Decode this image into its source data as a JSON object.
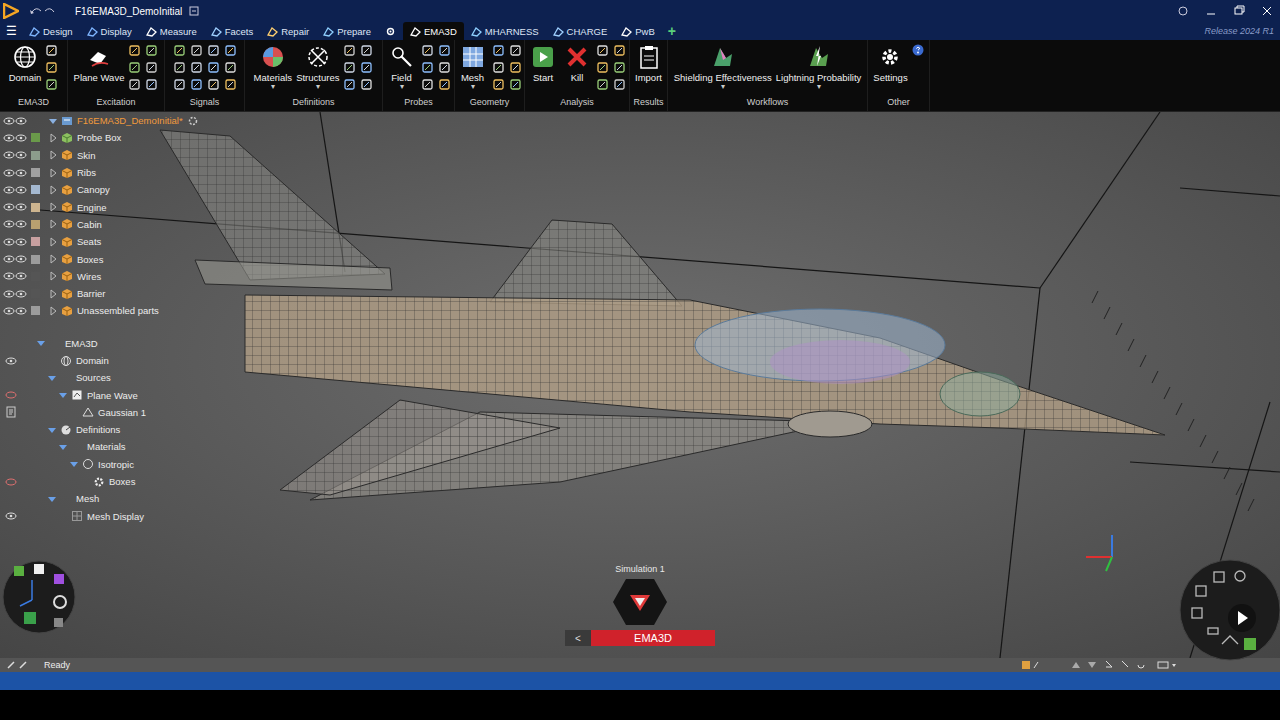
{
  "window": {
    "title": "F16EMA3D_DemoInitial",
    "release": "Release 2024 R1",
    "menu": "☰",
    "add_tab": "+",
    "dropdown_glyph": "▾"
  },
  "tabs": [
    {
      "kind": "text",
      "label": "Design",
      "selected": false
    },
    {
      "kind": "text",
      "label": "Display",
      "selected": false
    },
    {
      "kind": "text",
      "label": "Measure",
      "selected": false
    },
    {
      "kind": "text",
      "label": "Facets",
      "selected": false
    },
    {
      "kind": "text",
      "label": "Repair",
      "selected": false
    },
    {
      "kind": "text",
      "label": "Prepare",
      "selected": false
    },
    {
      "kind": "icon",
      "label": "",
      "selected": false
    },
    {
      "kind": "text",
      "label": "EMA3D",
      "selected": true
    },
    {
      "kind": "text",
      "label": "MHARNESS",
      "selected": false
    },
    {
      "kind": "text",
      "label": "CHARGE",
      "selected": false
    },
    {
      "kind": "text",
      "label": "PwB",
      "selected": false
    }
  ],
  "ribbon": [
    {
      "label": "EMA3D",
      "buttons": [
        {
          "label": "Domain",
          "dropdown": false
        }
      ]
    },
    {
      "label": "Excitation",
      "buttons": [
        {
          "label": "Plane Wave",
          "dropdown": false
        }
      ]
    },
    {
      "label": "Signals",
      "buttons": []
    },
    {
      "label": "Definitions",
      "buttons": [
        {
          "label": "Materials",
          "dropdown": true
        },
        {
          "label": "Structures",
          "dropdown": true
        }
      ]
    },
    {
      "label": "Probes",
      "buttons": [
        {
          "label": "Field",
          "dropdown": true
        }
      ]
    },
    {
      "label": "Geometry",
      "buttons": [
        {
          "label": "Mesh",
          "dropdown": true
        }
      ]
    },
    {
      "label": "Analysis",
      "buttons": [
        {
          "label": "Start",
          "dropdown": false
        },
        {
          "label": "Kill",
          "dropdown": false
        }
      ]
    },
    {
      "label": "Results",
      "buttons": [
        {
          "label": "Import",
          "dropdown": false
        }
      ]
    },
    {
      "label": "Workflows",
      "buttons": [
        {
          "label": "Shielding Effectiveness",
          "dropdown": true
        },
        {
          "label": "Lightning Probability",
          "dropdown": true
        }
      ]
    },
    {
      "label": "Other",
      "buttons": [
        {
          "label": "Settings",
          "dropdown": false
        }
      ]
    }
  ],
  "structure_tree": {
    "root": {
      "label": "F16EMA3D_DemoInitial*",
      "expanded": true
    },
    "items": [
      {
        "label": "Probe Box",
        "visible": true,
        "expanded": false,
        "kind": "body",
        "color": "#6a9a4a"
      },
      {
        "label": "Skin",
        "visible": true,
        "expanded": false,
        "kind": "component",
        "color": "#8c9c8c"
      },
      {
        "label": "Ribs",
        "visible": true,
        "expanded": false,
        "kind": "component",
        "color": "#a0a0a0"
      },
      {
        "label": "Canopy",
        "visible": true,
        "expanded": false,
        "kind": "component",
        "color": "#a4b8d0"
      },
      {
        "label": "Engine",
        "visible": true,
        "expanded": false,
        "kind": "component",
        "color": "#cdb48f"
      },
      {
        "label": "Cabin",
        "visible": true,
        "expanded": false,
        "kind": "component",
        "color": "#b8a070"
      },
      {
        "label": "Seats",
        "visible": true,
        "expanded": false,
        "kind": "component",
        "color": "#c8a0a0"
      },
      {
        "label": "Boxes",
        "visible": true,
        "expanded": false,
        "kind": "component",
        "color": "#9c9c9c"
      },
      {
        "label": "Wires",
        "visible": true,
        "expanded": false,
        "kind": "component",
        "color": "#555555"
      },
      {
        "label": "Barrier",
        "visible": true,
        "expanded": false,
        "kind": "component",
        "color": "#555555"
      },
      {
        "label": "Unassembled parts",
        "visible": true,
        "expanded": false,
        "kind": "component",
        "color": "#9c9c9c"
      }
    ]
  },
  "simulation_tree": [
    {
      "label": "EMA3D",
      "depth": 0,
      "has_children": true,
      "expanded": true,
      "eye": "none",
      "kind": "root"
    },
    {
      "label": "Domain",
      "depth": 1,
      "has_children": false,
      "expanded": false,
      "eye": "shown",
      "kind": "domain"
    },
    {
      "label": "Sources",
      "depth": 1,
      "has_children": true,
      "expanded": true,
      "eye": "none",
      "kind": "folder"
    },
    {
      "label": "Plane Wave",
      "depth": 2,
      "has_children": true,
      "expanded": true,
      "eye": "hidden",
      "kind": "source"
    },
    {
      "label": "Gaussian 1",
      "depth": 3,
      "has_children": false,
      "expanded": false,
      "eye": "note",
      "kind": "signal"
    },
    {
      "label": "Definitions",
      "depth": 1,
      "has_children": true,
      "expanded": true,
      "eye": "none",
      "kind": "definitions"
    },
    {
      "label": "Materials",
      "depth": 2,
      "has_children": true,
      "expanded": true,
      "eye": "none",
      "kind": "folder"
    },
    {
      "label": "Isotropic",
      "depth": 3,
      "has_children": true,
      "expanded": true,
      "eye": "none",
      "kind": "material"
    },
    {
      "label": "Boxes",
      "depth": 4,
      "has_children": false,
      "expanded": false,
      "eye": "hidden",
      "kind": "gear"
    },
    {
      "label": "Mesh",
      "depth": 1,
      "has_children": true,
      "expanded": true,
      "eye": "none",
      "kind": "folder"
    },
    {
      "label": "Mesh Display",
      "depth": 2,
      "has_children": false,
      "expanded": false,
      "eye": "shown",
      "kind": "mesh"
    }
  ],
  "viewport": {
    "simulation": "Simulation 1",
    "mode": "EMA3D",
    "back": "<"
  },
  "status_bar": {
    "text": "Ready"
  }
}
